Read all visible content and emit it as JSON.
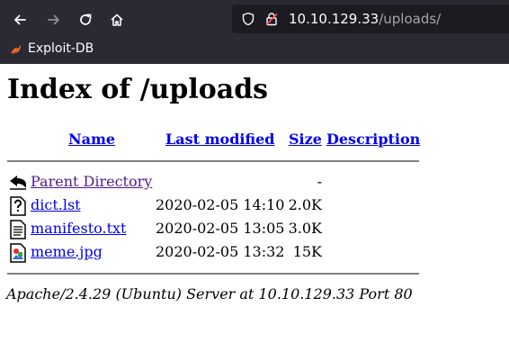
{
  "browser": {
    "url_host": "10.10.129.33",
    "url_path": "/uploads/",
    "bookmarks": [
      {
        "label": "Exploit-DB",
        "icon": "exploit-db-icon"
      }
    ],
    "icons": [
      "back-arrow-icon",
      "forward-arrow-icon",
      "reload-icon",
      "home-icon",
      "shield-icon",
      "insecure-lock-icon"
    ]
  },
  "page": {
    "title": "Index of /uploads",
    "columns": {
      "name": "Name",
      "last_modified": "Last modified",
      "size": "Size",
      "description": "Description"
    },
    "rows": [
      {
        "name": "Parent Directory",
        "modified": "",
        "size": "-",
        "icon": "back-folder-icon",
        "visited": true
      },
      {
        "name": "dict.lst",
        "modified": "2020-02-05 14:10",
        "size": "2.0K",
        "icon": "unknown-file-icon",
        "visited": false
      },
      {
        "name": "manifesto.txt",
        "modified": "2020-02-05 13:05",
        "size": "3.0K",
        "icon": "text-file-icon",
        "visited": false
      },
      {
        "name": "meme.jpg",
        "modified": "2020-02-05 13:32",
        "size": "15K",
        "icon": "image-file-icon",
        "visited": false
      }
    ],
    "footer": "Apache/2.4.29 (Ubuntu) Server at 10.10.129.33 Port 80"
  },
  "colors": {
    "chrome_bg": "#2b2a33",
    "urlbar_bg": "#1c1b22",
    "link": "#0000ee",
    "visited_link": "#551a8b",
    "rule": "#808080"
  }
}
